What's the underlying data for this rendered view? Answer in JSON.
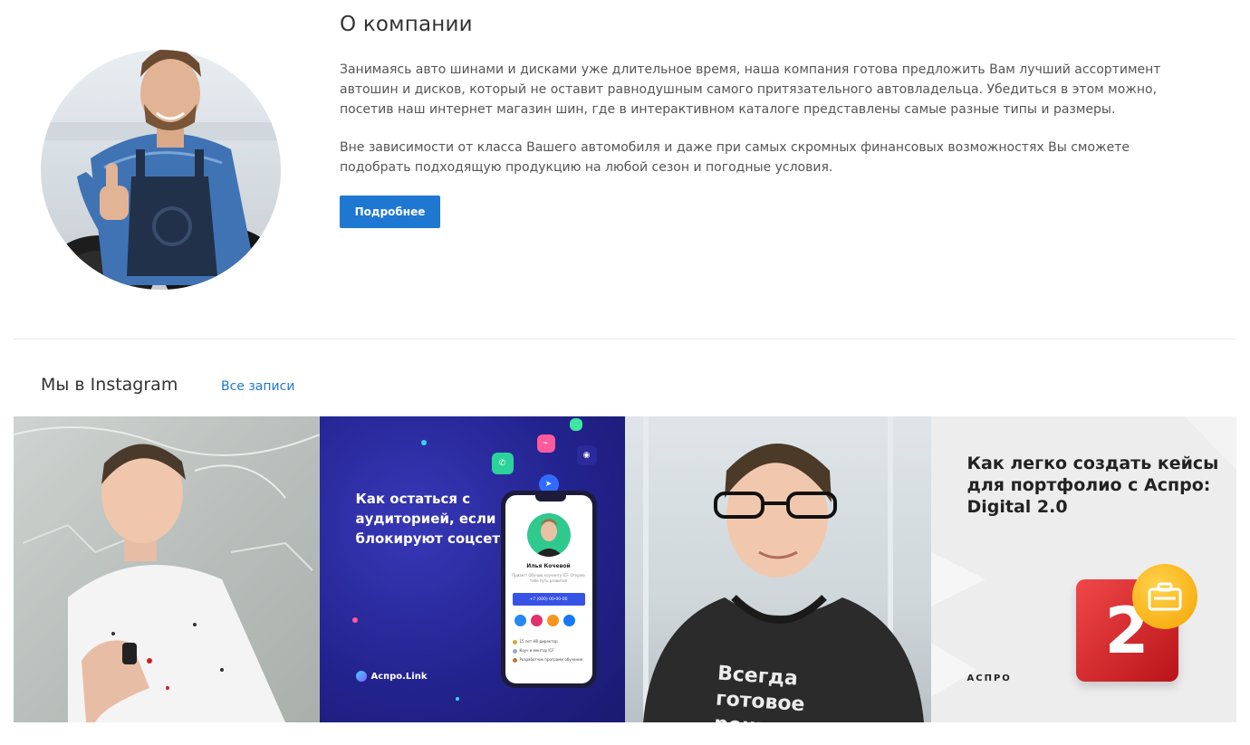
{
  "about": {
    "title": "О компании",
    "paragraph1": "Занимаясь авто шинами и дисками уже длительное время, наша компания готова предложить Вам лучший ассортимент автошин и дисков, который не оставит равнодушным самого притязательного автовладельца. Убедиться в этом можно, посетив наш интернет магазин шин, где в интерактивном каталоге представлены самые разные типы и размеры.",
    "paragraph2": "Вне зависимости от класса Вашего автомобиля и даже при самых скромных финансовых возможностях Вы сможете подобрать подходящую продукцию на любой сезон и погодные условия.",
    "button_label": "Подробнее"
  },
  "instagram": {
    "title": "Мы в Instagram",
    "all_link": "Все записи",
    "posts": [
      {
        "kind": "photo"
      },
      {
        "headline": "Как остаться с аудиторией, если блокируют соцсети?",
        "brand": "Аспро.Link",
        "phone_name": "Илья Кочевой",
        "phone_desc": "Привет! Обучаю коучингу ICF. Открою тебе путь развития",
        "phone_cta": "+7 (000) 00-00-00",
        "phone_list": [
          "15 лет HR-директор",
          "Коуч и ментор ICF",
          "Разработчик программ обучения"
        ]
      },
      {
        "shirt_text": "Всегда готовое реш"
      },
      {
        "headline": "Как легко создать кейсы для портфолио с Аспро: Digital 2.0",
        "brand": "АСПРО"
      }
    ]
  },
  "colors": {
    "accent": "#1e78d2",
    "text": "#333333",
    "muted": "#555555"
  }
}
